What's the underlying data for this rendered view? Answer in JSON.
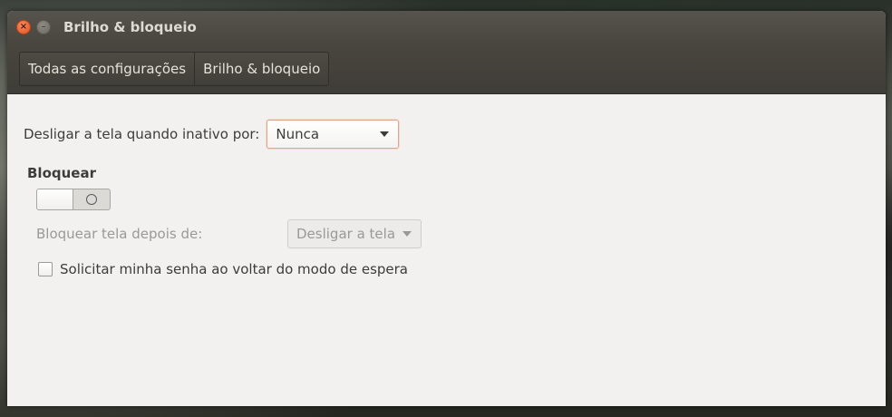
{
  "window": {
    "title": "Brilho & bloqueio"
  },
  "breadcrumb": {
    "items": [
      {
        "label": "Todas as configurações"
      },
      {
        "label": "Brilho & bloqueio"
      }
    ]
  },
  "screen_off": {
    "label": "Desligar a tela quando inativo por:",
    "selected": "Nunca"
  },
  "lock": {
    "section_title": "Bloquear",
    "switch_state": "off",
    "lock_after_label": "Bloquear tela depois de:",
    "lock_after_selected": "Desligar a tela",
    "password_label": "Solicitar minha senha ao voltar do modo de espera",
    "password_checked": false
  },
  "icons": {
    "close": "close-icon",
    "minimize": "minimize-icon",
    "dropdown": "chevron-down-icon"
  },
  "colors": {
    "accent": "#e95420",
    "titlebar": "#4c4a44",
    "background": "#f2f1f0"
  }
}
